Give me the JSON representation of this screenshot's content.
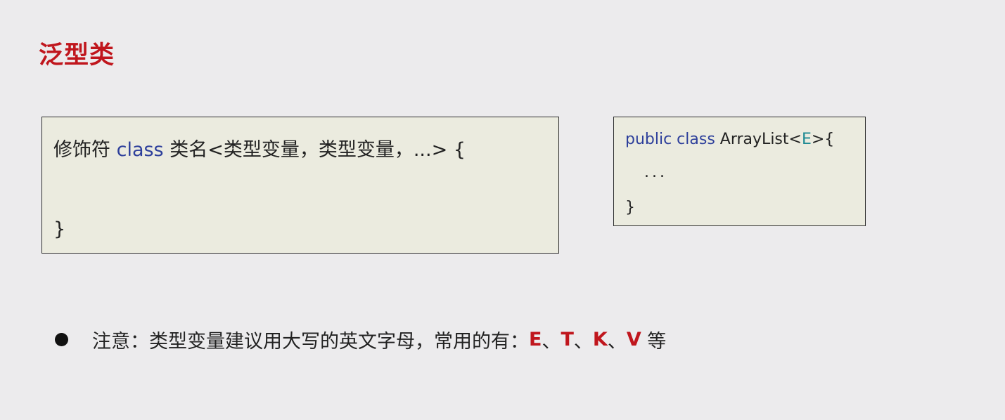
{
  "title": "泛型类",
  "syntax": {
    "prefix": "修饰符 ",
    "keyword": "class",
    "rest": " 类名<类型变量，类型变量，...> {",
    "closing": "}"
  },
  "example": {
    "keyword": "public class",
    "class_name": " ArrayList<",
    "type_var": "E",
    "suffix": ">{",
    "body": "...",
    "closing": "}"
  },
  "note": {
    "text": "注意：类型变量建议用大写的英文字母，常用的有：",
    "letters": [
      "E",
      "T",
      "K",
      "V"
    ],
    "separator": "、",
    "suffix": " 等"
  },
  "colors": {
    "accent_red": "#c0161d",
    "keyword_blue": "#2d3f9b",
    "typevar_teal": "#1f8a93",
    "box_bg": "#ebebdf",
    "page_bg": "#ecebed"
  }
}
